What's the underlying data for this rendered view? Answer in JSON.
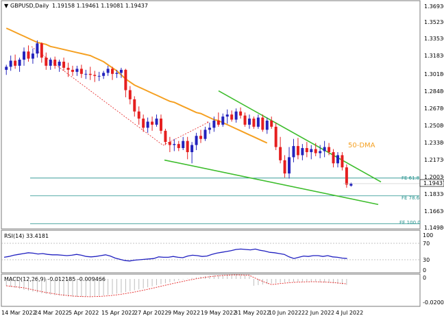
{
  "main": {
    "header": {
      "symbol": "GBPUSD,Daily",
      "ohlc": "1.19158 1.19461 1.19081 1.19437"
    },
    "price_axis": {
      "ticks": [
        "1.36930",
        "1.35230",
        "1.33530",
        "1.31830",
        "1.30180",
        "1.28480",
        "1.26780",
        "1.25080",
        "1.23380",
        "1.21730",
        "1.20030",
        "1.18330",
        "1.16630",
        "1.14980"
      ],
      "current_price_label": "1.19437"
    },
    "annotations": {
      "dma_label": "50-DMA",
      "fe_618": "FE 61.8",
      "fe_786": "FE 78.6",
      "fe_1000": "FE 100.0"
    }
  },
  "rsi": {
    "label": "RSI(14) 33.4181",
    "ticks": [
      "100",
      "70",
      "30",
      "0"
    ]
  },
  "macd": {
    "label": "MACD(12,26,9) -0.012185 -0.009466",
    "ticks": [
      "0",
      "-0.020059"
    ]
  },
  "time_axis": {
    "ticks": [
      "14 Mar 2022",
      "24 Mar 2022",
      "5 Apr 2022",
      "15 Apr 2022",
      "27 Apr 2022",
      "9 May 2022",
      "19 May 2022",
      "31 May 2022",
      "10 Jun 2022",
      "22 Jun 2022",
      "4 Jul 2022"
    ]
  },
  "colors": {
    "bull": "#2323bd",
    "bear": "#e51f1f",
    "sma": "#f5a021",
    "trend": "#3dbd2c",
    "fib": "#1f8f8a",
    "rsi": "#1f1fc0",
    "macd_signal": "#e32020",
    "macd_hist": "#bdbdbd"
  },
  "chart_data": {
    "type": "candlestick",
    "series": [
      {
        "name": "",
        "ohlc": [
          [
            1.306,
            1.311,
            1.301,
            1.309
          ],
          [
            1.309,
            1.32,
            1.305,
            1.315
          ],
          [
            1.315,
            1.321,
            1.307,
            1.31
          ],
          [
            1.31,
            1.318,
            1.304,
            1.316
          ],
          [
            1.316,
            1.328,
            1.31,
            1.324
          ],
          [
            1.324,
            1.33,
            1.314,
            1.317
          ],
          [
            1.317,
            1.327,
            1.312,
            1.322
          ],
          [
            1.322,
            1.335,
            1.318,
            1.332
          ],
          [
            1.332,
            1.333,
            1.313,
            1.318
          ],
          [
            1.318,
            1.323,
            1.306,
            1.31
          ],
          [
            1.31,
            1.318,
            1.306,
            1.316
          ],
          [
            1.316,
            1.319,
            1.307,
            1.31
          ],
          [
            1.31,
            1.316,
            1.304,
            1.314
          ],
          [
            1.314,
            1.318,
            1.305,
            1.308
          ],
          [
            1.308,
            1.313,
            1.299,
            1.306
          ],
          [
            1.306,
            1.31,
            1.3,
            1.304
          ],
          [
            1.304,
            1.31,
            1.3,
            1.307
          ],
          [
            1.307,
            1.311,
            1.298,
            1.302
          ],
          [
            1.302,
            1.306,
            1.297,
            1.302
          ],
          [
            1.302,
            1.309,
            1.296,
            1.301
          ],
          [
            1.301,
            1.305,
            1.294,
            1.3
          ],
          [
            1.3,
            1.304,
            1.295,
            1.3
          ],
          [
            1.3,
            1.305,
            1.297,
            1.303
          ],
          [
            1.303,
            1.31,
            1.3,
            1.307
          ],
          [
            1.307,
            1.309,
            1.296,
            1.302
          ],
          [
            1.302,
            1.306,
            1.298,
            1.303
          ],
          [
            1.303,
            1.308,
            1.298,
            1.306
          ],
          [
            1.306,
            1.307,
            1.279,
            1.286
          ],
          [
            1.286,
            1.29,
            1.272,
            1.277
          ],
          [
            1.277,
            1.28,
            1.26,
            1.265
          ],
          [
            1.265,
            1.27,
            1.252,
            1.258
          ],
          [
            1.258,
            1.262,
            1.245,
            1.249
          ],
          [
            1.249,
            1.259,
            1.244,
            1.255
          ],
          [
            1.255,
            1.26,
            1.246,
            1.252
          ],
          [
            1.252,
            1.262,
            1.25,
            1.258
          ],
          [
            1.258,
            1.262,
            1.243,
            1.246
          ],
          [
            1.246,
            1.248,
            1.232,
            1.235
          ],
          [
            1.235,
            1.24,
            1.225,
            1.232
          ],
          [
            1.232,
            1.238,
            1.226,
            1.233
          ],
          [
            1.233,
            1.236,
            1.226,
            1.229
          ],
          [
            1.229,
            1.24,
            1.227,
            1.236
          ],
          [
            1.236,
            1.24,
            1.218,
            1.225
          ],
          [
            1.225,
            1.235,
            1.214,
            1.232
          ],
          [
            1.232,
            1.244,
            1.227,
            1.241
          ],
          [
            1.241,
            1.247,
            1.234,
            1.238
          ],
          [
            1.238,
            1.25,
            1.236,
            1.247
          ],
          [
            1.247,
            1.254,
            1.243,
            1.249
          ],
          [
            1.249,
            1.26,
            1.245,
            1.256
          ],
          [
            1.256,
            1.264,
            1.25,
            1.252
          ],
          [
            1.252,
            1.263,
            1.25,
            1.26
          ],
          [
            1.26,
            1.267,
            1.253,
            1.262
          ],
          [
            1.262,
            1.266,
            1.255,
            1.257
          ],
          [
            1.257,
            1.268,
            1.254,
            1.265
          ],
          [
            1.265,
            1.269,
            1.258,
            1.261
          ],
          [
            1.261,
            1.264,
            1.25,
            1.252
          ],
          [
            1.252,
            1.262,
            1.248,
            1.258
          ],
          [
            1.258,
            1.26,
            1.248,
            1.25
          ],
          [
            1.25,
            1.262,
            1.248,
            1.259
          ],
          [
            1.259,
            1.262,
            1.245,
            1.247
          ],
          [
            1.247,
            1.259,
            1.243,
            1.256
          ],
          [
            1.256,
            1.26,
            1.248,
            1.25
          ],
          [
            1.25,
            1.254,
            1.227,
            1.23
          ],
          [
            1.23,
            1.24,
            1.214,
            1.217
          ],
          [
            1.217,
            1.222,
            1.2,
            1.204
          ],
          [
            1.204,
            1.23,
            1.199,
            1.22
          ],
          [
            1.22,
            1.238,
            1.215,
            1.231
          ],
          [
            1.231,
            1.239,
            1.218,
            1.222
          ],
          [
            1.222,
            1.233,
            1.217,
            1.229
          ],
          [
            1.229,
            1.235,
            1.22,
            1.225
          ],
          [
            1.225,
            1.232,
            1.218,
            1.228
          ],
          [
            1.228,
            1.234,
            1.221,
            1.224
          ],
          [
            1.224,
            1.232,
            1.219,
            1.226
          ],
          [
            1.226,
            1.236,
            1.22,
            1.23
          ],
          [
            1.23,
            1.234,
            1.222,
            1.225
          ],
          [
            1.225,
            1.228,
            1.21,
            1.214
          ],
          [
            1.214,
            1.225,
            1.21,
            1.222
          ],
          [
            1.222,
            1.225,
            1.207,
            1.21
          ],
          [
            1.21,
            1.213,
            1.19,
            1.193
          ],
          [
            1.192,
            1.195,
            1.191,
            1.194
          ]
        ]
      },
      {
        "name": "50-DMA",
        "values": [
          1.347,
          1.345,
          1.343,
          1.341,
          1.339,
          1.337,
          1.335,
          1.333,
          1.332,
          1.331,
          1.329,
          1.328,
          1.327,
          1.326,
          1.325,
          1.324,
          1.323,
          1.322,
          1.321,
          1.32,
          1.318,
          1.316,
          1.314,
          1.311,
          1.308,
          1.305,
          1.301,
          1.297,
          1.294,
          1.291,
          1.289,
          1.287,
          1.285,
          1.283,
          1.281,
          1.279,
          1.277,
          1.275,
          1.274,
          1.272,
          1.27,
          1.268,
          1.266,
          1.264,
          1.263,
          1.261,
          1.259,
          1.257,
          1.256,
          1.254,
          1.252,
          1.25,
          1.248,
          1.246,
          1.244,
          1.242,
          1.24,
          1.238,
          1.236,
          1.234
        ]
      },
      {
        "name": "RSI(14)",
        "values": [
          36,
          38,
          41,
          43,
          45,
          47,
          46,
          44,
          45,
          43,
          42,
          42,
          41,
          40,
          41,
          43,
          41,
          38,
          37,
          38,
          40,
          42,
          39,
          34,
          31,
          28,
          27,
          29,
          30,
          31,
          32,
          33,
          37,
          36,
          36,
          38,
          36,
          35,
          39,
          41,
          40,
          38,
          39,
          43,
          46,
          48,
          50,
          52,
          55,
          56,
          55,
          54,
          56,
          53,
          51,
          48,
          47,
          45,
          43,
          37,
          33,
          36,
          39,
          38,
          40,
          40,
          38,
          40,
          37,
          36,
          34,
          33
        ]
      }
    ],
    "ylim": [
      1.1498,
      1.3693
    ]
  },
  "chart_lines": {
    "fe": [
      1.1995,
      1.182,
      1.1545
    ],
    "resistance": [
      1.2853,
      1.1957
    ],
    "support": [
      1.2172,
      1.1735
    ],
    "rsi_levels": [
      70,
      30
    ]
  }
}
